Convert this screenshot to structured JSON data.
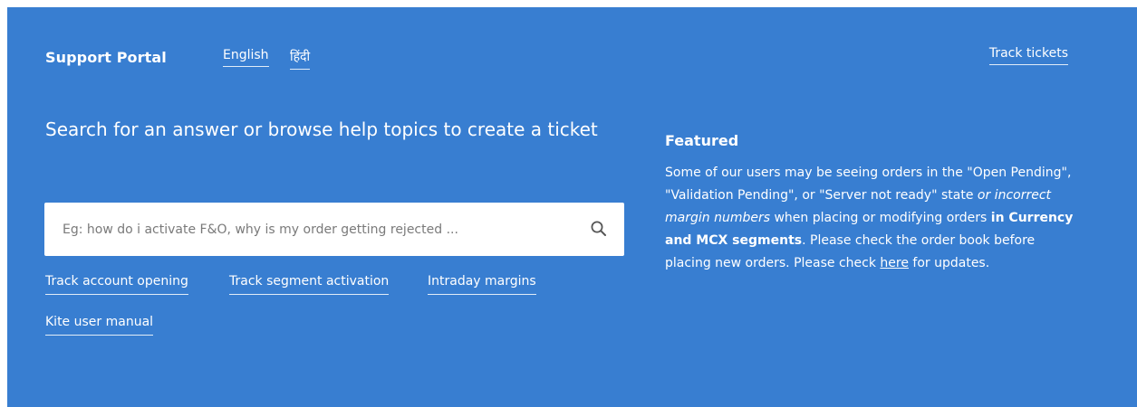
{
  "header": {
    "brand": "Support Portal",
    "languages": [
      "English",
      "हिंदी"
    ],
    "track_tickets": "Track tickets"
  },
  "hero": {
    "headline": "Search for an answer or browse help topics to create a ticket"
  },
  "search": {
    "placeholder": "Eg: how do i activate F&O, why is my order getting rejected ..."
  },
  "quick_links": [
    "Track account opening",
    "Track segment activation",
    "Intraday margins",
    "Kite user manual"
  ],
  "featured": {
    "title": "Featured",
    "text_1": "Some of our users may be seeing orders in the \"Open Pending\", \"Validation Pending\", or \"Server not ready\" state ",
    "text_italic": "or incorrect margin numbers",
    "text_2": " when placing or modifying orders ",
    "text_bold": "in Currency and MCX segments",
    "text_3": ". Please check the order book before placing new orders. Please check ",
    "link": "here",
    "text_4": " for updates."
  },
  "colors": {
    "background": "#387ed1",
    "text": "#ffffff",
    "search_bg": "#ffffff",
    "placeholder": "#7a7a7a"
  }
}
